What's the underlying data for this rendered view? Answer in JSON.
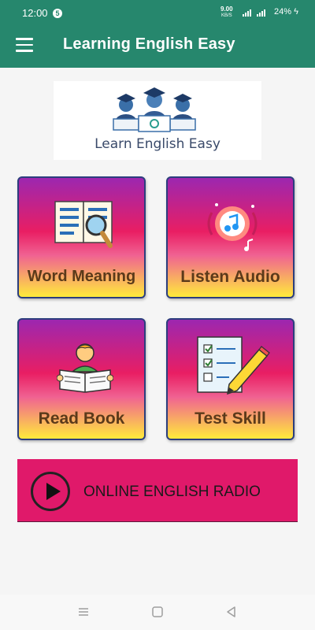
{
  "status": {
    "time": "12:00",
    "notification_count": "5",
    "net_speed": "9.00",
    "net_unit": "KB/S",
    "battery": "24%"
  },
  "appbar": {
    "title": "Learning English Easy"
  },
  "logo": {
    "text": "Learn English Easy"
  },
  "cards": [
    {
      "label": "Word Meaning",
      "icon": "book-search-icon"
    },
    {
      "label": "Listen Audio",
      "icon": "music-audio-icon"
    },
    {
      "label": "Read Book",
      "icon": "reading-person-icon"
    },
    {
      "label": "Test Skill",
      "icon": "checklist-pencil-icon"
    }
  ],
  "radio": {
    "label": "ONLINE ENGLISH RADIO",
    "icon": "play-icon"
  },
  "navbar": {
    "items": [
      "recent-apps-icon",
      "home-icon",
      "back-icon"
    ]
  },
  "colors": {
    "primary": "#26876d",
    "card_border": "#2c3e7e",
    "radio_bg": "#e0196a",
    "card_text": "#5b3a1a"
  }
}
